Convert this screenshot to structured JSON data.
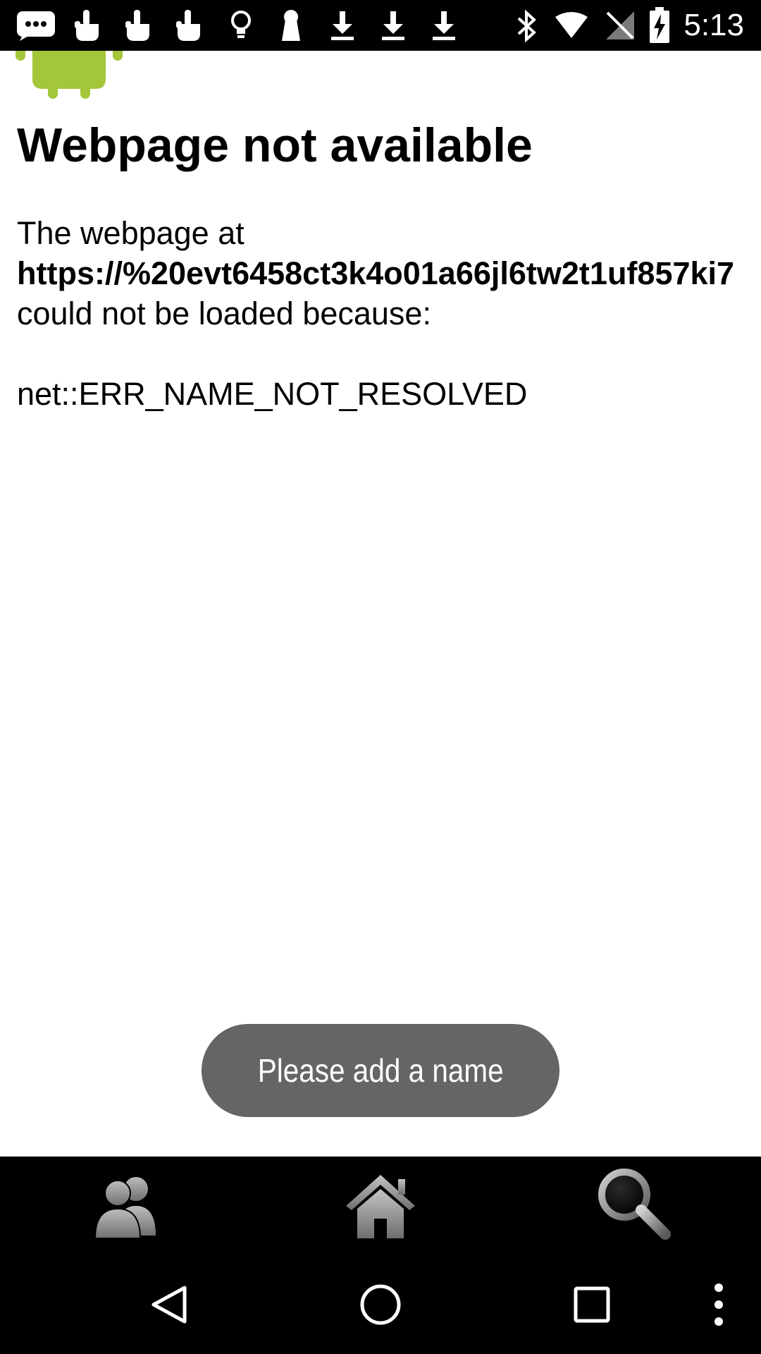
{
  "status_bar": {
    "time": "5:13",
    "icons": [
      "messages-icon",
      "hand-touch-icon",
      "hand-touch-icon",
      "hand-touch-icon",
      "lightbulb-icon",
      "keyhole-icon",
      "download-icon",
      "download-icon",
      "download-icon",
      "bluetooth-icon",
      "wifi-icon",
      "no-signal-icon",
      "battery-charging-icon"
    ]
  },
  "webview": {
    "title": "Webpage not available",
    "message_prefix": "The webpage at",
    "url": "https://%20evt6458ct3k4o01a66jl6tw2t1uf857ki7",
    "message_suffix": "could not be loaded because:",
    "error_code": "net::ERR_NAME_NOT_RESOLVED"
  },
  "toast": {
    "text": "Please add a name"
  },
  "app_bar": {
    "items": [
      {
        "icon": "people-icon"
      },
      {
        "icon": "home-icon"
      },
      {
        "icon": "search-icon"
      }
    ]
  },
  "nav_bar": {
    "items": [
      "back-icon",
      "home-circle-icon",
      "recents-icon",
      "overflow-menu-icon"
    ]
  },
  "colors": {
    "status_bar_bg": "#000000",
    "toast_bg": "#656565",
    "android_green": "#a4c639",
    "icon_gray": "#9e9e9e"
  }
}
